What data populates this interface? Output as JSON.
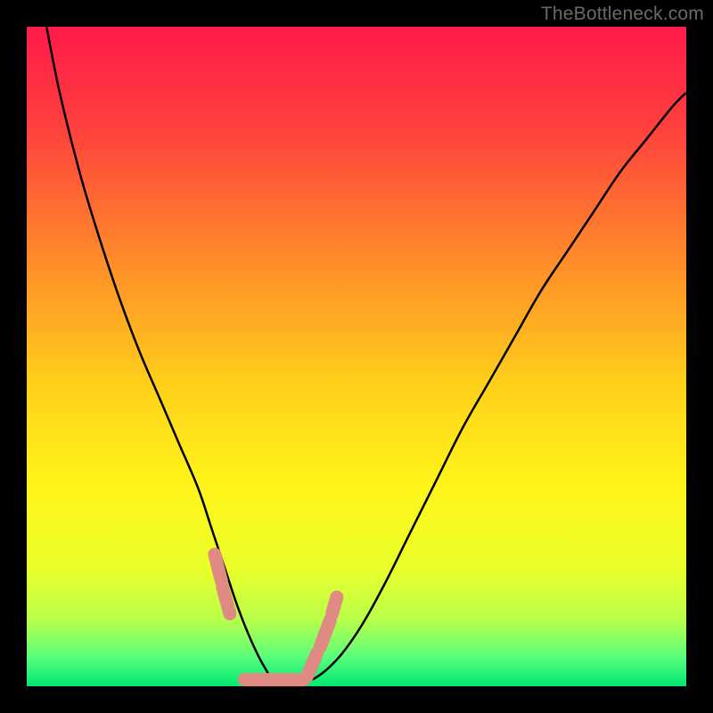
{
  "watermark": "TheBottleneck.com",
  "chart_data": {
    "type": "line",
    "title": "",
    "xlabel": "",
    "ylabel": "",
    "xlim": [
      0,
      100
    ],
    "ylim": [
      0,
      100
    ],
    "legend": false,
    "grid": false,
    "background_gradient": {
      "stops": [
        {
          "offset": 0.0,
          "color": "#ff1a4a"
        },
        {
          "offset": 0.15,
          "color": "#ff3f3d"
        },
        {
          "offset": 0.35,
          "color": "#ff8a2a"
        },
        {
          "offset": 0.55,
          "color": "#ffd21a"
        },
        {
          "offset": 0.7,
          "color": "#fff51a"
        },
        {
          "offset": 0.82,
          "color": "#eaff2a"
        },
        {
          "offset": 0.9,
          "color": "#b8ff4a"
        },
        {
          "offset": 0.955,
          "color": "#5aff7a"
        },
        {
          "offset": 1.0,
          "color": "#00e873"
        }
      ]
    },
    "series": [
      {
        "name": "curve",
        "color": "#000000",
        "x": [
          3,
          5,
          8,
          11,
          14,
          17,
          20,
          23,
          26,
          28,
          30,
          32,
          34,
          36,
          38,
          42,
          46,
          50,
          54,
          58,
          62,
          66,
          70,
          74,
          78,
          82,
          86,
          90,
          94,
          98,
          100
        ],
        "y": [
          100,
          90,
          78,
          68,
          59,
          51,
          44,
          37,
          30,
          24,
          18,
          12,
          7,
          3,
          0.5,
          0.5,
          3,
          8,
          15,
          23,
          31,
          39,
          46,
          53,
          60,
          66,
          72,
          78,
          83,
          88,
          90
        ]
      }
    ],
    "highlight_segments": {
      "color": "#e08a84",
      "description": "thick pink overlay segments near the curve minimum",
      "segments": [
        {
          "x1": 28.5,
          "y1": 20,
          "x2": 29.5,
          "y2": 16
        },
        {
          "x1": 29.7,
          "y1": 15,
          "x2": 30.8,
          "y2": 11
        },
        {
          "x1": 33.0,
          "y1": 1.0,
          "x2": 42.0,
          "y2": 1.0
        },
        {
          "x1": 42.5,
          "y1": 1.5,
          "x2": 44.0,
          "y2": 5.0
        },
        {
          "x1": 44.5,
          "y1": 6.0,
          "x2": 46.0,
          "y2": 10.0
        },
        {
          "x1": 46.3,
          "y1": 11.0,
          "x2": 47.0,
          "y2": 13.5
        }
      ]
    }
  }
}
